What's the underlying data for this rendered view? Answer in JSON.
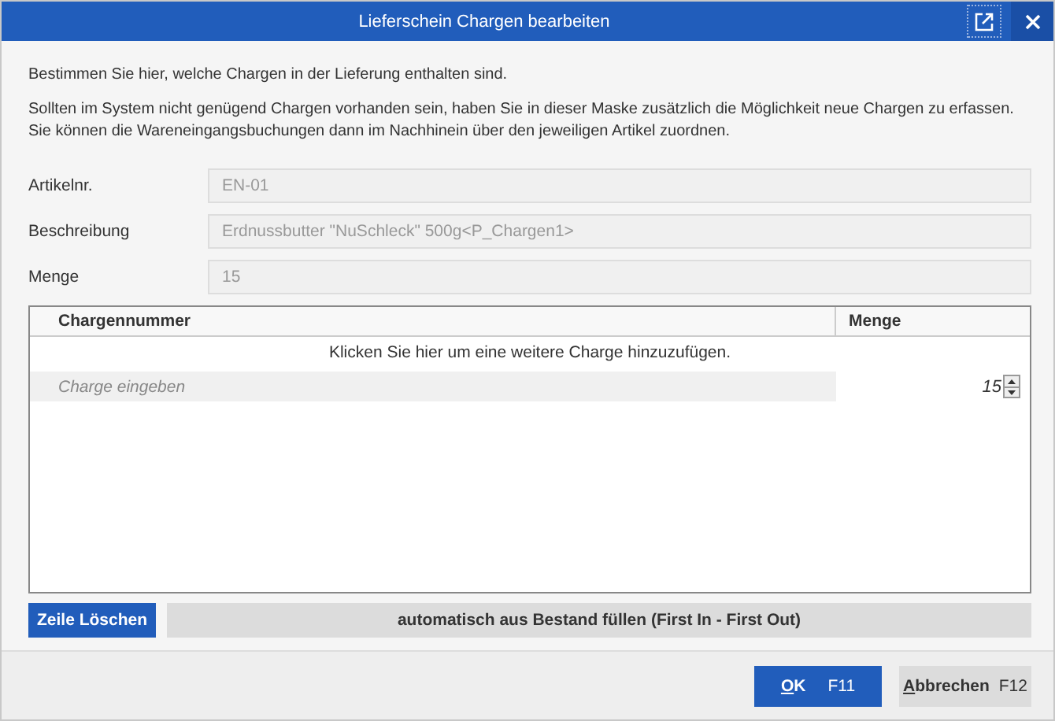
{
  "window": {
    "title": "Lieferschein Chargen bearbeiten"
  },
  "intro": [
    "Bestimmen Sie hier, welche Chargen in der Lieferung enthalten sind.",
    "Sollten im System nicht genügend Chargen vorhanden sein, haben Sie in dieser Maske zusätzlich die Möglichkeit neue Chargen zu erfassen. Sie können die Wareneingangsbuchungen dann im Nachhinein über den jeweiligen Artikel zuordnen."
  ],
  "fields": [
    {
      "label": "Artikelnr.",
      "value": "EN-01",
      "disabled": true
    },
    {
      "label": "Beschreibung",
      "value": "Erdnussbutter \"NuSchleck\" 500g<P_Chargen1>",
      "disabled": true
    },
    {
      "label": "Menge",
      "value": "15",
      "disabled": true
    }
  ],
  "table": {
    "columns": [
      "Chargennummer",
      "Menge"
    ],
    "add_row_hint": "Klicken Sie hier um eine weitere Charge hinzuzufügen.",
    "rows": [
      {
        "placeholder": "Charge eingeben",
        "quantity": "15"
      }
    ]
  },
  "actions": [
    {
      "label": "Zeile Löschen",
      "kind": "primary"
    },
    {
      "label": "automatisch aus Bestand füllen (First In - First Out)",
      "kind": "secondary"
    }
  ],
  "footer_buttons": [
    {
      "mnemonic": "O",
      "label_rest": "K",
      "shortcut": "F11",
      "kind": "primary"
    },
    {
      "mnemonic": "A",
      "label_rest": "bbrechen",
      "shortcut": "F12",
      "kind": "secondary"
    }
  ]
}
